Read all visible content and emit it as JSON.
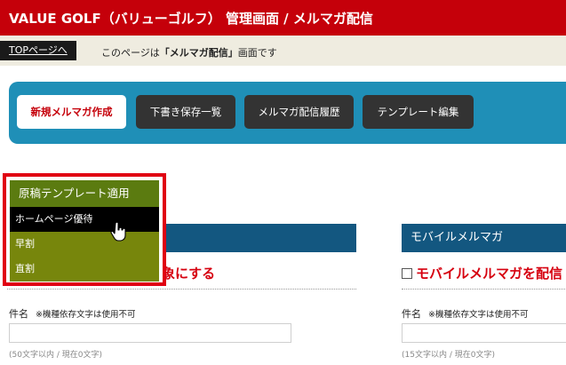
{
  "header": {
    "title": "VALUE GOLF（バリューゴルフ） 管理画面 / メルマガ配信"
  },
  "breadcrumb": {
    "top_link": "TOPページへ",
    "prefix": "このページは",
    "page_name": "「メルマガ配信」",
    "suffix": "画面です"
  },
  "toolbar": {
    "buttons": [
      {
        "label": "新規メルマガ作成"
      },
      {
        "label": "下書き保存一覧"
      },
      {
        "label": "メルマガ配信履歴"
      },
      {
        "label": "テンプレート編集"
      }
    ]
  },
  "template_menu": {
    "title": "原稿テンプレート適用",
    "items": [
      {
        "label": "ホームページ優待"
      },
      {
        "label": "早割"
      },
      {
        "label": "直割"
      }
    ]
  },
  "columns": {
    "pc": {
      "checkbox_label": "象にする",
      "subject_label": "件名",
      "subject_note": "※機種依存文字は使用不可",
      "subject_value": "",
      "hint": "(50文字以内 / 現在0文字)"
    },
    "mobile": {
      "heading": "モバイルメルマガ",
      "checkbox_label": "モバイルメルマガを配信",
      "subject_label": "件名",
      "subject_note": "※機種依存文字は使用不可",
      "subject_value": "",
      "hint": "(15文字以内 / 現在0文字)"
    }
  },
  "colors": {
    "header": "#c5000a",
    "toolbar": "#1f8fb7",
    "column_heading": "#135780",
    "menu_head": "#5b7b10",
    "menu_item": "#77860c",
    "highlight_border": "#e00012"
  },
  "icons": {
    "cursor": "hand-pointer-icon",
    "checkbox": "checkbox-icon"
  }
}
